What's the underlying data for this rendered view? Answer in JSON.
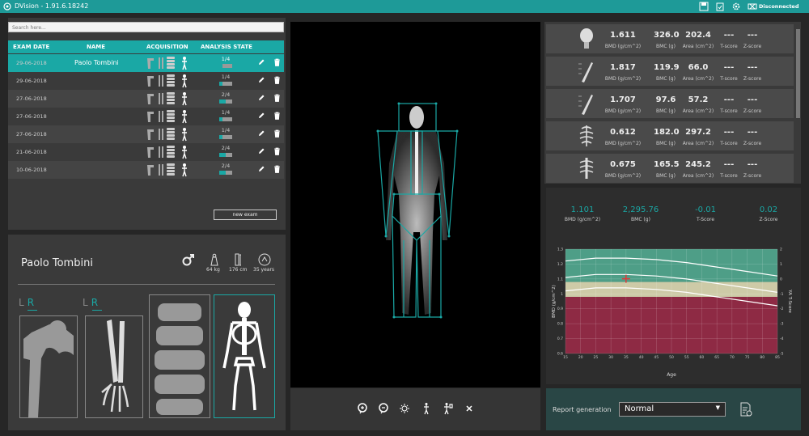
{
  "app": {
    "title": "DVision - 1.91.6.18242",
    "status": "Disconnected"
  },
  "search": {
    "placeholder": "Search here..."
  },
  "exams": {
    "headers": [
      "EXAM DATE",
      "NAME",
      "ACQUISITION",
      "ANALYSIS STATE"
    ],
    "rows": [
      {
        "date": "29-06-2018",
        "name": "Paolo Tombini",
        "state": "1/4",
        "progress": 0.25,
        "selected": true
      },
      {
        "date": "29-06-2018",
        "name": "",
        "state": "1/4",
        "progress": 0.25
      },
      {
        "date": "27-06-2018",
        "name": "",
        "state": "2/4",
        "progress": 0.5
      },
      {
        "date": "27-06-2018",
        "name": "",
        "state": "1/4",
        "progress": 0.25
      },
      {
        "date": "27-06-2018",
        "name": "",
        "state": "1/4",
        "progress": 0.25
      },
      {
        "date": "21-06-2018",
        "name": "",
        "state": "2/4",
        "progress": 0.5
      },
      {
        "date": "10-06-2018",
        "name": "",
        "state": "2/4",
        "progress": 0.5
      }
    ],
    "new_exam_label": "new exam"
  },
  "patient": {
    "name": "Paolo Tombini",
    "weight": "64 kg",
    "height": "176 cm",
    "age": "35 years",
    "side_left": "L",
    "side_right": "R"
  },
  "results": [
    {
      "region": "skull-icon",
      "bmd": "1.611",
      "bmc": "326.0",
      "area": "202.4",
      "tscore": "---",
      "zscore": "---"
    },
    {
      "region": "arm-icon",
      "bmd": "1.817",
      "bmc": "119.9",
      "area": "66.0",
      "tscore": "---",
      "zscore": "---"
    },
    {
      "region": "arm-icon",
      "bmd": "1.707",
      "bmc": "97.6",
      "area": "57.2",
      "tscore": "---",
      "zscore": "---"
    },
    {
      "region": "ribs-icon",
      "bmd": "0.612",
      "bmc": "182.0",
      "area": "297.2",
      "tscore": "---",
      "zscore": "---"
    },
    {
      "region": "spine-icon",
      "bmd": "0.675",
      "bmc": "165.5",
      "area": "245.2",
      "tscore": "---",
      "zscore": "---"
    }
  ],
  "result_units": {
    "bmd": "BMD (g/cm^2)",
    "bmc": "BMC (g)",
    "area": "Area (cm^2)",
    "tscore": "T-score",
    "zscore": "Z-score"
  },
  "summary": {
    "bmd": "1.101",
    "bmd_unit": "BMD (g/cm^2)",
    "bmc": "2,295.76",
    "bmc_unit": "BMC (g)",
    "tscore": "-0.01",
    "tscore_unit": "T-Score",
    "zscore": "0.02",
    "zscore_unit": "Z-Score"
  },
  "chart_data": {
    "type": "line",
    "xlabel": "Age",
    "ylabel": "BMD (g/cm^2)",
    "y2label": "YA T-Score",
    "xlim": [
      15,
      85
    ],
    "ylim": [
      0.6,
      1.3
    ],
    "y2lim": [
      -5,
      2
    ],
    "xticks": [
      "15",
      "20",
      "25",
      "30",
      "35",
      "40",
      "45",
      "50",
      "55",
      "60",
      "65",
      "70",
      "75",
      "80",
      "85"
    ],
    "yticks": [
      "0.6",
      "0.7",
      "0.8",
      "0.9",
      "1",
      "1.1",
      "1.2",
      "1.3"
    ],
    "y2ticks": [
      "-5",
      "-4",
      "-3",
      "-2",
      "-1",
      "0",
      "1",
      "2"
    ],
    "bands": [
      {
        "from": 0.6,
        "to": 0.98,
        "color": "#8e2a44"
      },
      {
        "from": 0.98,
        "to": 1.08,
        "color": "#cdcaa7"
      },
      {
        "from": 1.08,
        "to": 1.3,
        "color": "#4e9e87"
      }
    ],
    "series": [
      {
        "x": [
          15,
          25,
          35,
          45,
          55,
          65,
          75,
          85
        ],
        "values": [
          1.22,
          1.24,
          1.24,
          1.23,
          1.21,
          1.18,
          1.15,
          1.12
        ]
      },
      {
        "x": [
          15,
          25,
          35,
          45,
          55,
          65,
          75,
          85
        ],
        "values": [
          1.11,
          1.13,
          1.13,
          1.12,
          1.1,
          1.07,
          1.04,
          1.01
        ]
      },
      {
        "x": [
          15,
          25,
          35,
          45,
          55,
          65,
          75,
          85
        ],
        "values": [
          1.02,
          1.04,
          1.04,
          1.03,
          1.01,
          0.98,
          0.95,
          0.92
        ]
      }
    ],
    "point": {
      "x": 35,
      "y": 1.101
    },
    "grid": true
  },
  "report": {
    "label": "Report generation",
    "value": "Normal"
  },
  "colors": {
    "accent": "#1aa8a5",
    "titlebar": "#1e9a98"
  }
}
